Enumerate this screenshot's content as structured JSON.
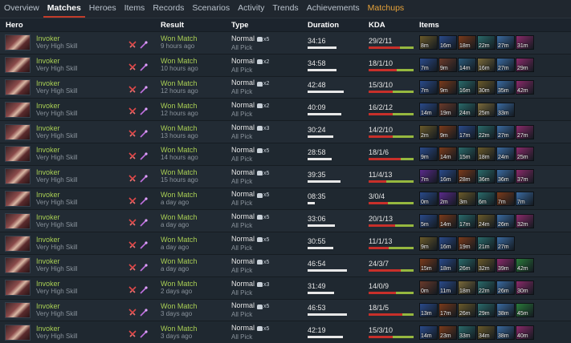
{
  "nav": {
    "tabs": [
      "Overview",
      "Matches",
      "Heroes",
      "Items",
      "Records",
      "Scenarios",
      "Activity",
      "Trends",
      "Achievements",
      "Matchups"
    ],
    "active": "Matches",
    "highlight": "Matchups"
  },
  "header": {
    "hero": "Hero",
    "result": "Result",
    "type": "Type",
    "duration": "Duration",
    "kda": "KDA",
    "items": "Items"
  },
  "colors": {
    "win": "#a9cf54",
    "kills": "#c8302a",
    "assists": "#96b83f",
    "accent": "#c23c2a",
    "highlight": "#e5a23a"
  },
  "icons": {
    "role_1": "crossed-swords-icon",
    "role_2": "staff-icon",
    "party": "party-icon"
  },
  "matches": [
    {
      "hero": "Invoker",
      "skill": "Very High Skill",
      "result": "Won Match",
      "time": "9 hours ago",
      "type": "Normal",
      "party": "x5",
      "mode": "All Pick",
      "duration": "34:16",
      "dur_min": 34.27,
      "kda": "29/2/11",
      "k": 29,
      "d": 2,
      "a": 11,
      "items": [
        {
          "t": "8m",
          "c": "#6a5a2a"
        },
        {
          "t": "16m",
          "c": "#2a4a8a"
        },
        {
          "t": "18m",
          "c": "#7a3a1a"
        },
        {
          "t": "22m",
          "c": "#2a6a6a"
        },
        {
          "t": "27m",
          "c": "#3a6aa0"
        },
        {
          "t": "31m",
          "c": "#8a2a6a"
        }
      ]
    },
    {
      "hero": "Invoker",
      "skill": "Very High Skill",
      "result": "Won Match",
      "time": "10 hours ago",
      "type": "Normal",
      "party": "x2",
      "mode": "All Pick",
      "duration": "34:58",
      "dur_min": 34.97,
      "kda": "18/1/10",
      "k": 18,
      "d": 1,
      "a": 10,
      "items": [
        {
          "t": "7m",
          "c": "#2a4a8a"
        },
        {
          "t": "9m",
          "c": "#6a3a2a"
        },
        {
          "t": "14m",
          "c": "#2a5a7a"
        },
        {
          "t": "16m",
          "c": "#7a6a3a"
        },
        {
          "t": "27m",
          "c": "#3a6aa0"
        },
        {
          "t": "29m",
          "c": "#8a2a6a"
        }
      ]
    },
    {
      "hero": "Invoker",
      "skill": "Very High Skill",
      "result": "Won Match",
      "time": "12 hours ago",
      "type": "Normal",
      "party": "x2",
      "mode": "All Pick",
      "duration": "42:48",
      "dur_min": 42.8,
      "kda": "15/3/10",
      "k": 15,
      "d": 3,
      "a": 10,
      "items": [
        {
          "t": "7m",
          "c": "#2a4a8a"
        },
        {
          "t": "9m",
          "c": "#7a3a1a"
        },
        {
          "t": "16m",
          "c": "#2a6a6a"
        },
        {
          "t": "30m",
          "c": "#6a5a2a"
        },
        {
          "t": "35m",
          "c": "#3a6aa0"
        },
        {
          "t": "42m",
          "c": "#8a2a6a"
        }
      ]
    },
    {
      "hero": "Invoker",
      "skill": "Very High Skill",
      "result": "Won Match",
      "time": "12 hours ago",
      "type": "Normal",
      "party": "x2",
      "mode": "All Pick",
      "duration": "40:09",
      "dur_min": 40.15,
      "kda": "16/2/12",
      "k": 16,
      "d": 2,
      "a": 12,
      "items": [
        {
          "t": "14m",
          "c": "#2a4a8a"
        },
        {
          "t": "19m",
          "c": "#6a3a2a"
        },
        {
          "t": "24m",
          "c": "#2a6a6a"
        },
        {
          "t": "25m",
          "c": "#7a6a3a"
        },
        {
          "t": "33m",
          "c": "#3a6aa0"
        }
      ]
    },
    {
      "hero": "Invoker",
      "skill": "Very High Skill",
      "result": "Won Match",
      "time": "13 hours ago",
      "type": "Normal",
      "party": "x3",
      "mode": "All Pick",
      "duration": "30:24",
      "dur_min": 30.4,
      "kda": "14/2/10",
      "k": 14,
      "d": 2,
      "a": 10,
      "items": [
        {
          "t": "2m",
          "c": "#6a5a2a"
        },
        {
          "t": "9m",
          "c": "#7a3a1a"
        },
        {
          "t": "17m",
          "c": "#2a4a8a"
        },
        {
          "t": "22m",
          "c": "#2a6a6a"
        },
        {
          "t": "27m",
          "c": "#3a6aa0"
        },
        {
          "t": "27m",
          "c": "#8a2a6a"
        }
      ]
    },
    {
      "hero": "Invoker",
      "skill": "Very High Skill",
      "result": "Won Match",
      "time": "14 hours ago",
      "type": "Normal",
      "party": "x5",
      "mode": "All Pick",
      "duration": "28:58",
      "dur_min": 28.97,
      "kda": "18/1/6",
      "k": 18,
      "d": 1,
      "a": 6,
      "items": [
        {
          "t": "9m",
          "c": "#2a4a8a"
        },
        {
          "t": "14m",
          "c": "#7a3a1a"
        },
        {
          "t": "15m",
          "c": "#2a6a6a"
        },
        {
          "t": "18m",
          "c": "#6a5a2a"
        },
        {
          "t": "24m",
          "c": "#3a6aa0"
        },
        {
          "t": "25m",
          "c": "#8a2a6a"
        }
      ]
    },
    {
      "hero": "Invoker",
      "skill": "Very High Skill",
      "result": "Won Match",
      "time": "15 hours ago",
      "type": "Normal",
      "party": "x5",
      "mode": "All Pick",
      "duration": "39:35",
      "dur_min": 39.58,
      "kda": "11/4/13",
      "k": 11,
      "d": 4,
      "a": 13,
      "items": [
        {
          "t": "7m",
          "c": "#5a2a8a"
        },
        {
          "t": "16m",
          "c": "#2a4a8a"
        },
        {
          "t": "28m",
          "c": "#7a3a1a"
        },
        {
          "t": "36m",
          "c": "#2a6a6a"
        },
        {
          "t": "36m",
          "c": "#3a6aa0"
        },
        {
          "t": "37m",
          "c": "#8a2a6a"
        }
      ]
    },
    {
      "hero": "Invoker",
      "skill": "Very High Skill",
      "result": "Won Match",
      "time": "a day ago",
      "type": "Normal",
      "party": "x5",
      "mode": "All Pick",
      "duration": "08:35",
      "dur_min": 8.58,
      "kda": "3/0/4",
      "k": 3,
      "d": 0,
      "a": 4,
      "items": [
        {
          "t": "0m",
          "c": "#2a4a8a"
        },
        {
          "t": "2m",
          "c": "#5a2a8a"
        },
        {
          "t": "3m",
          "c": "#6a5a2a"
        },
        {
          "t": "6m",
          "c": "#2a6a6a"
        },
        {
          "t": "7m",
          "c": "#7a3a1a"
        },
        {
          "t": "7m",
          "c": "#3a6aa0"
        }
      ]
    },
    {
      "hero": "Invoker",
      "skill": "Very High Skill",
      "result": "Won Match",
      "time": "a day ago",
      "type": "Normal",
      "party": "x5",
      "mode": "All Pick",
      "duration": "33:06",
      "dur_min": 33.1,
      "kda": "20/1/13",
      "k": 20,
      "d": 1,
      "a": 13,
      "items": [
        {
          "t": "5m",
          "c": "#2a4a8a"
        },
        {
          "t": "14m",
          "c": "#7a3a1a"
        },
        {
          "t": "17m",
          "c": "#2a6a6a"
        },
        {
          "t": "24m",
          "c": "#6a5a2a"
        },
        {
          "t": "26m",
          "c": "#3a6aa0"
        },
        {
          "t": "32m",
          "c": "#8a2a6a"
        }
      ]
    },
    {
      "hero": "Invoker",
      "skill": "Very High Skill",
      "result": "Won Match",
      "time": "a day ago",
      "type": "Normal",
      "party": "x5",
      "mode": "All Pick",
      "duration": "30:55",
      "dur_min": 30.92,
      "kda": "11/1/13",
      "k": 11,
      "d": 1,
      "a": 13,
      "items": [
        {
          "t": "9m",
          "c": "#6a5a2a"
        },
        {
          "t": "16m",
          "c": "#2a4a8a"
        },
        {
          "t": "19m",
          "c": "#7a3a1a"
        },
        {
          "t": "21m",
          "c": "#2a6a6a"
        },
        {
          "t": "27m",
          "c": "#3a6aa0"
        }
      ]
    },
    {
      "hero": "Invoker",
      "skill": "Very High Skill",
      "result": "Won Match",
      "time": "a day ago",
      "type": "Normal",
      "party": "x5",
      "mode": "All Pick",
      "duration": "46:54",
      "dur_min": 46.9,
      "kda": "24/3/7",
      "k": 24,
      "d": 3,
      "a": 7,
      "items": [
        {
          "t": "15m",
          "c": "#7a3a1a"
        },
        {
          "t": "18m",
          "c": "#2a4a8a"
        },
        {
          "t": "26m",
          "c": "#2a6a6a"
        },
        {
          "t": "32m",
          "c": "#6a5a2a"
        },
        {
          "t": "39m",
          "c": "#8a2a6a"
        },
        {
          "t": "42m",
          "c": "#2a7a3a"
        }
      ]
    },
    {
      "hero": "Invoker",
      "skill": "Very High Skill",
      "result": "Won Match",
      "time": "2 days ago",
      "type": "Normal",
      "party": "x3",
      "mode": "All Pick",
      "duration": "31:49",
      "dur_min": 31.82,
      "kda": "14/0/9",
      "k": 14,
      "d": 0,
      "a": 9,
      "items": [
        {
          "t": "0m",
          "c": "#6a3a2a"
        },
        {
          "t": "11m",
          "c": "#2a4a8a"
        },
        {
          "t": "18m",
          "c": "#7a6a3a"
        },
        {
          "t": "22m",
          "c": "#2a6a6a"
        },
        {
          "t": "26m",
          "c": "#3a6aa0"
        },
        {
          "t": "30m",
          "c": "#8a2a6a"
        }
      ]
    },
    {
      "hero": "Invoker",
      "skill": "Very High Skill",
      "result": "Won Match",
      "time": "3 days ago",
      "type": "Normal",
      "party": "x5",
      "mode": "All Pick",
      "duration": "46:53",
      "dur_min": 46.88,
      "kda": "18/1/5",
      "k": 18,
      "d": 1,
      "a": 5,
      "items": [
        {
          "t": "13m",
          "c": "#2a4a8a"
        },
        {
          "t": "17m",
          "c": "#7a3a1a"
        },
        {
          "t": "26m",
          "c": "#6a5a2a"
        },
        {
          "t": "29m",
          "c": "#2a6a6a"
        },
        {
          "t": "38m",
          "c": "#3a6aa0"
        },
        {
          "t": "45m",
          "c": "#2a7a3a"
        }
      ]
    },
    {
      "hero": "Invoker",
      "skill": "Very High Skill",
      "result": "Won Match",
      "time": "3 days ago",
      "type": "Normal",
      "party": "x5",
      "mode": "All Pick",
      "duration": "42:19",
      "dur_min": 42.32,
      "kda": "15/3/10",
      "k": 15,
      "d": 3,
      "a": 10,
      "items": [
        {
          "t": "14m",
          "c": "#2a4a8a"
        },
        {
          "t": "23m",
          "c": "#7a3a1a"
        },
        {
          "t": "33m",
          "c": "#2a6a6a"
        },
        {
          "t": "34m",
          "c": "#6a5a2a"
        },
        {
          "t": "38m",
          "c": "#3a6aa0"
        },
        {
          "t": "40m",
          "c": "#8a2a6a"
        }
      ]
    }
  ]
}
